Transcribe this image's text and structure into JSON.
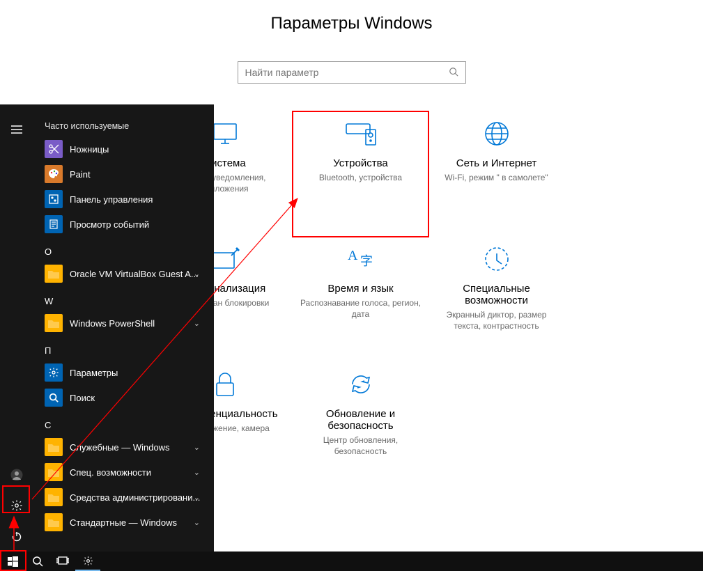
{
  "settings": {
    "title": "Параметры Windows",
    "search_placeholder": "Найти параметр",
    "tiles": [
      {
        "key": "system",
        "name": "Система",
        "desc": "Экран, уведомления, приложения"
      },
      {
        "key": "devices",
        "name": "Устройства",
        "desc": "Bluetooth, устройства",
        "highlight": true
      },
      {
        "key": "network",
        "name": "Сеть и Интернет",
        "desc": "Wi-Fi, режим \" в самолете\""
      },
      {
        "key": "personalization",
        "name": "Персонализация",
        "desc": "Фон, экран блокировки"
      },
      {
        "key": "timelang",
        "name": "Время и язык",
        "desc": "Распознавание голоса, регион, дата"
      },
      {
        "key": "ease",
        "name": "Специальные возможности",
        "desc": "Экранный диктор, размер текста, контрастность"
      },
      {
        "key": "privacy",
        "name": "Конфиденциальность",
        "desc": "Расположение, камера"
      },
      {
        "key": "update",
        "name": "Обновление и безопасность",
        "desc": "Центр обновления, безопасность"
      }
    ]
  },
  "startmenu": {
    "most_used_header": "Часто используемые",
    "most_used": [
      {
        "name": "Ножницы",
        "icon": "scissors",
        "color": "#7a5cc7"
      },
      {
        "name": "Paint",
        "icon": "paint",
        "color": "#d97a2b"
      },
      {
        "name": "Панель управления",
        "icon": "control-panel",
        "color": "#0064b3"
      },
      {
        "name": "Просмотр событий",
        "icon": "event-viewer",
        "color": "#0064b3"
      }
    ],
    "letters": [
      {
        "letter": "O",
        "items": [
          {
            "name": "Oracle VM VirtualBox Guest A...",
            "icon": "folder",
            "expand": true
          }
        ]
      },
      {
        "letter": "W",
        "items": [
          {
            "name": "Windows PowerShell",
            "icon": "folder",
            "expand": true
          }
        ]
      },
      {
        "letter": "П",
        "items": [
          {
            "name": "Параметры",
            "icon": "gear",
            "color": "#0064b3"
          },
          {
            "name": "Поиск",
            "icon": "search",
            "color": "#0064b3"
          }
        ]
      },
      {
        "letter": "С",
        "items": [
          {
            "name": "Служебные — Windows",
            "icon": "folder",
            "expand": true
          },
          {
            "name": "Спец. возможности",
            "icon": "folder",
            "expand": true
          },
          {
            "name": "Средства администрировани...",
            "icon": "folder",
            "expand": true
          },
          {
            "name": "Стандартные — Windows",
            "icon": "folder",
            "expand": true
          }
        ]
      }
    ]
  },
  "taskbar": {
    "buttons": [
      "start",
      "search",
      "taskview",
      "settings"
    ]
  },
  "colors": {
    "accent": "#0078d7",
    "highlight": "#ff0000"
  }
}
